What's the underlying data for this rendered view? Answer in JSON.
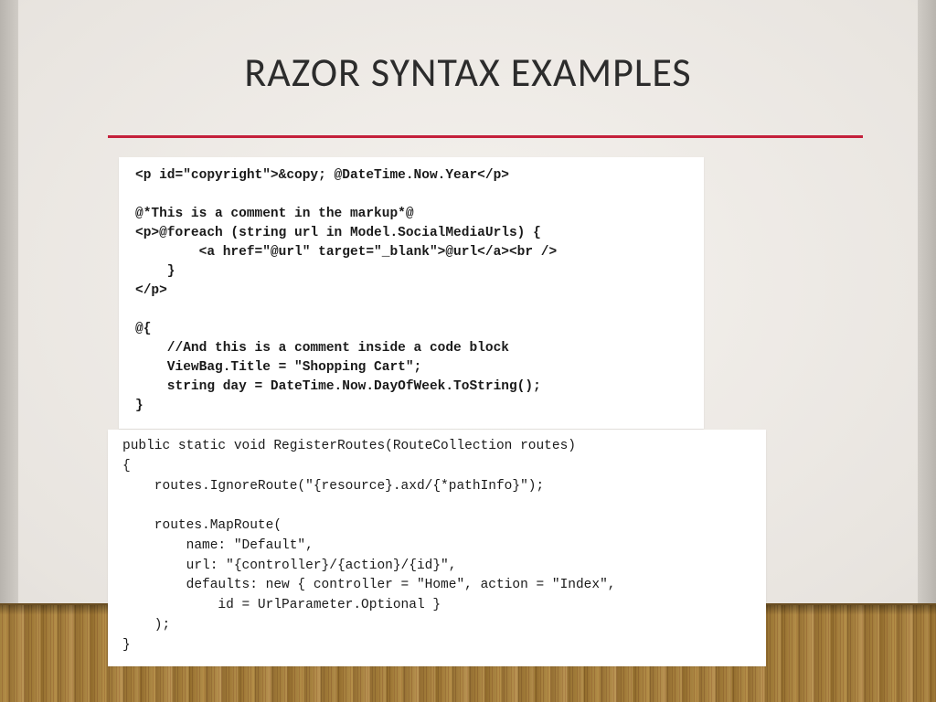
{
  "slide": {
    "title": "RAZOR SYNTAX EXAMPLES",
    "code_block_1": "<p id=\"copyright\">&copy; @DateTime.Now.Year</p>\n\n@*This is a comment in the markup*@\n<p>@foreach (string url in Model.SocialMediaUrls) {\n        <a href=\"@url\" target=\"_blank\">@url</a><br />\n    }\n</p>\n\n@{\n    //And this is a comment inside a code block\n    ViewBag.Title = \"Shopping Cart\";\n    string day = DateTime.Now.DayOfWeek.ToString();\n}",
    "code_block_2": "public static void RegisterRoutes(RouteCollection routes)\n{\n    routes.IgnoreRoute(\"{resource}.axd/{*pathInfo}\");\n\n    routes.MapRoute(\n        name: \"Default\",\n        url: \"{controller}/{action}/{id}\",\n        defaults: new { controller = \"Home\", action = \"Index\",\n            id = UrlParameter.Optional }\n    );\n}"
  }
}
